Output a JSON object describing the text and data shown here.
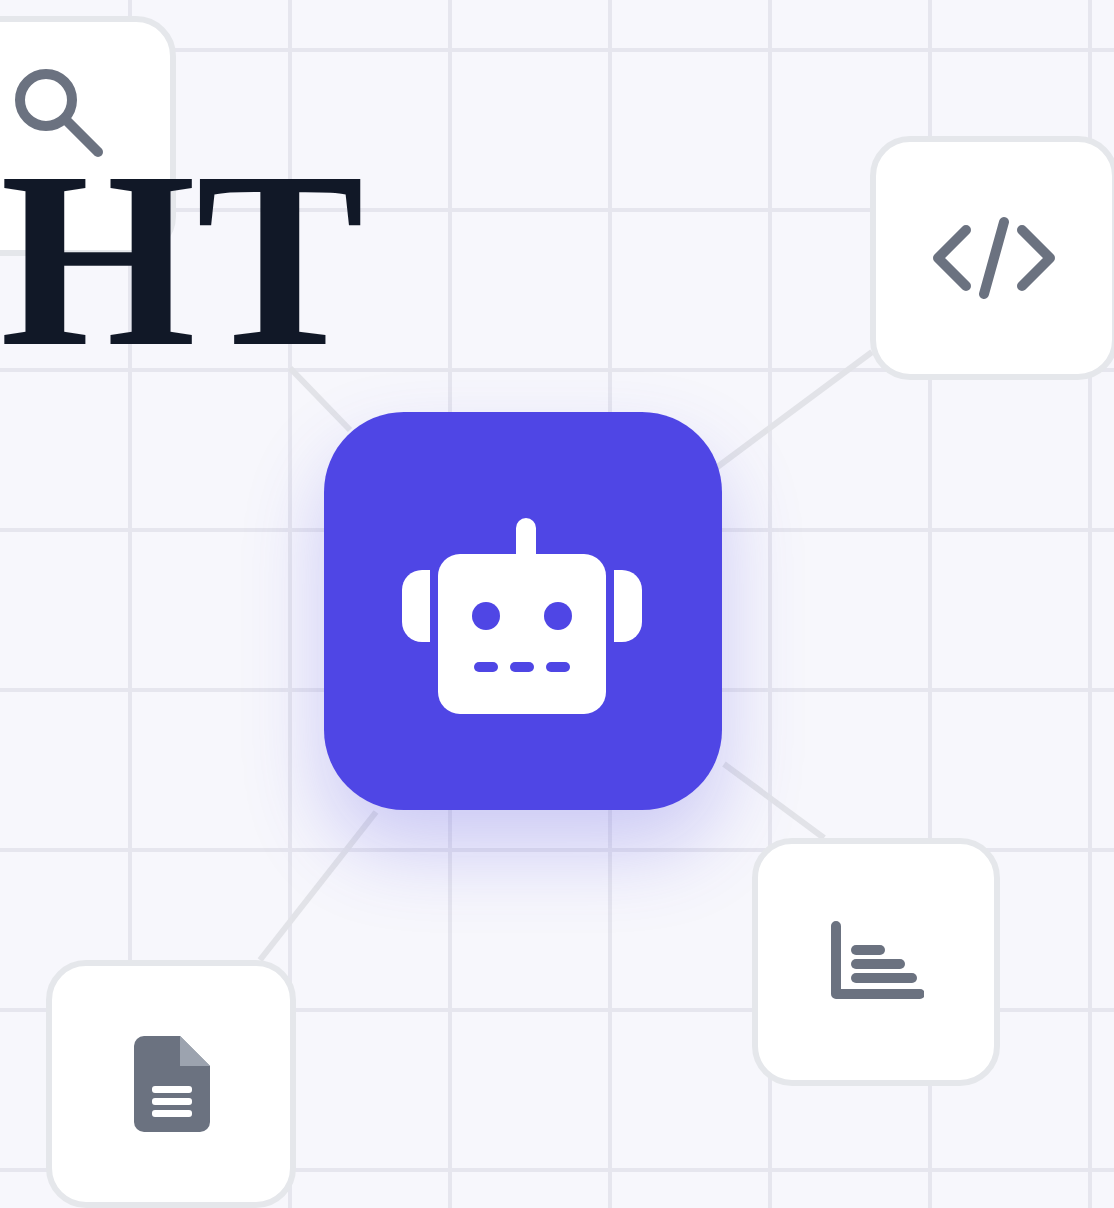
{
  "headline_fragment": "HT",
  "nodes": [
    {
      "kind": "search"
    },
    {
      "kind": "code"
    },
    {
      "kind": "hub"
    },
    {
      "kind": "chart"
    },
    {
      "kind": "document"
    }
  ]
}
